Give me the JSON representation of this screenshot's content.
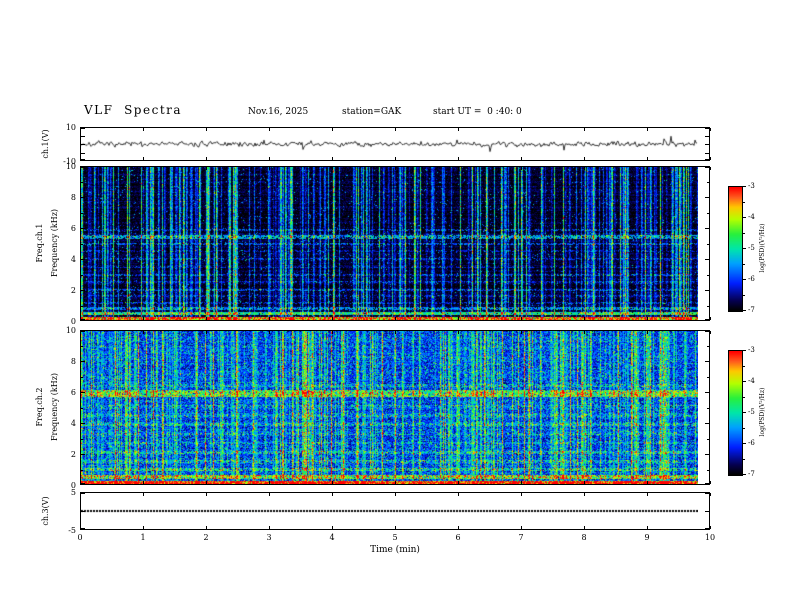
{
  "header": {
    "title": "VLF  Spectra",
    "date": "Nov.16, 2025",
    "station": "station=GAK",
    "start_ut": "start UT =  0 :40: 0"
  },
  "xaxis": {
    "label": "Time (min)",
    "min": 0,
    "max": 10,
    "ticks": [
      0,
      1,
      2,
      3,
      4,
      5,
      6,
      7,
      8,
      9,
      10
    ],
    "data_end_min": 9.8
  },
  "colorbar": {
    "label": "log(PSD)(V²/Hz)",
    "min": -7,
    "max": -3,
    "ticks": [
      -3,
      -4,
      -5,
      -6,
      -7
    ]
  },
  "panels": {
    "wave1": {
      "ylabel": "ch.1(V)",
      "ymin": -10,
      "ymax": 10,
      "yticks_major": [
        10,
        5,
        0,
        -5,
        -10
      ],
      "ytick_labels": [
        10,
        -10
      ]
    },
    "spec1": {
      "ylabel_outer": "Freq.ch.1",
      "ylabel_inner": "Frequency (kHz)",
      "ymin": 0,
      "ymax": 10,
      "yticks_major": [
        0,
        2,
        4,
        6,
        8,
        10
      ],
      "yticks_minor": [
        1,
        3,
        5,
        7,
        9
      ],
      "ytick_labels": [
        10,
        8,
        6,
        4,
        2,
        0
      ]
    },
    "spec2": {
      "ylabel_outer": "Freq.ch.2",
      "ylabel_inner": "Frequency (kHz)",
      "ymin": 0,
      "ymax": 10,
      "yticks_major": [
        0,
        2,
        4,
        6,
        8,
        10
      ],
      "yticks_minor": [
        1,
        3,
        5,
        7,
        9
      ],
      "ytick_labels": [
        10,
        8,
        6,
        4,
        2,
        0
      ]
    },
    "wave3": {
      "ylabel": "ch.3(V)",
      "ymin": -5,
      "ymax": 5,
      "yticks_major": [
        5,
        0,
        -5
      ],
      "ytick_labels": [
        5,
        -5
      ]
    }
  },
  "chart_data": [
    {
      "type": "line",
      "name": "ch.1 waveform",
      "panel": "wave1",
      "xlim": [
        0,
        9.8
      ],
      "ylim": [
        -10,
        10
      ],
      "ylabel": "ch.1(V)",
      "summary": "high-frequency noise trace centred on 0 V, typical excursions about ±2 V with sporadic impulses up to ±6 V across the full 0–9.8 min record",
      "gen": {
        "seed": 7,
        "noise_v": 2.2,
        "spike_prob": 0.02,
        "spike_min_v": 3,
        "spike_max_v": 7
      }
    },
    {
      "type": "heatmap",
      "name": "ch.1 VLF spectrogram",
      "panel": "spec1",
      "xlim": [
        0,
        9.8
      ],
      "ylim": [
        0,
        10
      ],
      "zlim": [
        -7,
        -3
      ],
      "summary": "background near the -7 noise floor (black/dark blue); dense vertical sferic streaks in cyan/green at all frequencies; persistent horizontal emission bands near 0.1, 0.45, 0.8, 2, 3, 4, 5 and 5.5 kHz; the lowest band saturates to yellow/orange",
      "gen": {
        "seed": 1301,
        "base": -6.85,
        "noise": 0.55,
        "speckle_prob": 0.045,
        "speckle_amp": 1.7,
        "row_jitter": 0.3,
        "bands": [
          {
            "f": 0.1,
            "w": 0.14,
            "boost": 3.4,
            "p": 1.0
          },
          {
            "f": 0.45,
            "w": 0.1,
            "boost": 2.0,
            "p": 0.95
          },
          {
            "f": 0.8,
            "w": 0.09,
            "boost": 1.3,
            "p": 0.8
          },
          {
            "f": 1.15,
            "w": 0.07,
            "boost": 0.9,
            "p": 0.6
          },
          {
            "f": 1.6,
            "w": 0.06,
            "boost": 0.7,
            "p": 0.5
          },
          {
            "f": 2.0,
            "w": 0.07,
            "boost": 0.9,
            "p": 0.55
          },
          {
            "f": 2.5,
            "w": 0.06,
            "boost": 0.7,
            "p": 0.5
          },
          {
            "f": 3.0,
            "w": 0.07,
            "boost": 0.8,
            "p": 0.5
          },
          {
            "f": 3.5,
            "w": 0.06,
            "boost": 0.6,
            "p": 0.45
          },
          {
            "f": 4.0,
            "w": 0.07,
            "boost": 0.8,
            "p": 0.5
          },
          {
            "f": 4.55,
            "w": 0.06,
            "boost": 0.7,
            "p": 0.45
          },
          {
            "f": 5.0,
            "w": 0.09,
            "boost": 1.0,
            "p": 0.6
          },
          {
            "f": 5.45,
            "w": 0.12,
            "boost": 1.5,
            "p": 0.75
          },
          {
            "f": 5.9,
            "w": 0.08,
            "boost": 0.9,
            "p": 0.4
          }
        ],
        "streaks": {
          "count": 240,
          "min": 0.5,
          "max": 2.7
        }
      }
    },
    {
      "type": "heatmap",
      "name": "ch.2 VLF spectrogram",
      "panel": "spec2",
      "xlim": [
        0,
        9.8
      ],
      "ylim": [
        0,
        10
      ],
      "zlim": [
        -7,
        -3
      ],
      "summary": "higher overall power: blue/cyan background with heavy green speckle, strong yellow-green band near 6 kHz, intense yellow/red band below 0.3 kHz, and the same dense vertical sferic streaks",
      "gen": {
        "seed": 2902,
        "base": -6.1,
        "noise": 1.0,
        "speckle_prob": 0.3,
        "speckle_amp": 1.4,
        "row_jitter": 0.3,
        "bands": [
          {
            "f": 0.1,
            "w": 0.16,
            "boost": 3.0,
            "p": 1.0
          },
          {
            "f": 0.5,
            "w": 0.12,
            "boost": 1.7,
            "p": 0.9
          },
          {
            "f": 0.95,
            "w": 0.1,
            "boost": 1.1,
            "p": 0.7
          },
          {
            "f": 1.5,
            "w": 0.08,
            "boost": 0.8,
            "p": 0.6
          },
          {
            "f": 2.1,
            "w": 0.1,
            "boost": 0.9,
            "p": 0.65
          },
          {
            "f": 2.7,
            "w": 0.08,
            "boost": 0.7,
            "p": 0.55
          },
          {
            "f": 3.3,
            "w": 0.08,
            "boost": 0.7,
            "p": 0.5
          },
          {
            "f": 3.9,
            "w": 0.1,
            "boost": 0.8,
            "p": 0.55
          },
          {
            "f": 4.5,
            "w": 0.08,
            "boost": 0.6,
            "p": 0.5
          },
          {
            "f": 5.1,
            "w": 0.08,
            "boost": 0.6,
            "p": 0.5
          },
          {
            "f": 5.95,
            "w": 0.22,
            "boost": 1.5,
            "p": 0.9
          },
          {
            "f": 6.45,
            "w": 0.1,
            "boost": 0.8,
            "p": 0.5
          }
        ],
        "streaks": {
          "count": 260,
          "min": 0.6,
          "max": 2.4
        }
      }
    },
    {
      "type": "line",
      "name": "ch.3 waveform",
      "panel": "wave3",
      "xlim": [
        0,
        9.8
      ],
      "ylim": [
        -5,
        5
      ],
      "ylabel": "ch.3(V)",
      "summary": "constant trace at ≈0 V for the whole record, drawn as a heavy dotted line",
      "value": 0,
      "gen": {
        "dot_step": 3,
        "dot_size": 2
      }
    },
    {
      "type": "colorbar",
      "name": "PSD colour scale",
      "panel": "colorbar",
      "range": [
        -7,
        -3
      ],
      "ticks": [
        -3,
        -4,
        -5,
        -6,
        -7
      ],
      "label": "log(PSD)(V²/Hz)",
      "colormap": [
        {
          "t": 0.0,
          "rgb": [
            0,
            0,
            0
          ]
        },
        {
          "t": 0.08,
          "rgb": [
            5,
            0,
            80
          ]
        },
        {
          "t": 0.22,
          "rgb": [
            0,
            30,
            255
          ]
        },
        {
          "t": 0.38,
          "rgb": [
            0,
            160,
            255
          ]
        },
        {
          "t": 0.5,
          "rgb": [
            0,
            230,
            170
          ]
        },
        {
          "t": 0.62,
          "rgb": [
            40,
            240,
            60
          ]
        },
        {
          "t": 0.74,
          "rgb": [
            180,
            255,
            0
          ]
        },
        {
          "t": 0.84,
          "rgb": [
            255,
            200,
            0
          ]
        },
        {
          "t": 0.92,
          "rgb": [
            255,
            90,
            30
          ]
        },
        {
          "t": 1.0,
          "rgb": [
            255,
            0,
            0
          ]
        }
      ]
    }
  ]
}
